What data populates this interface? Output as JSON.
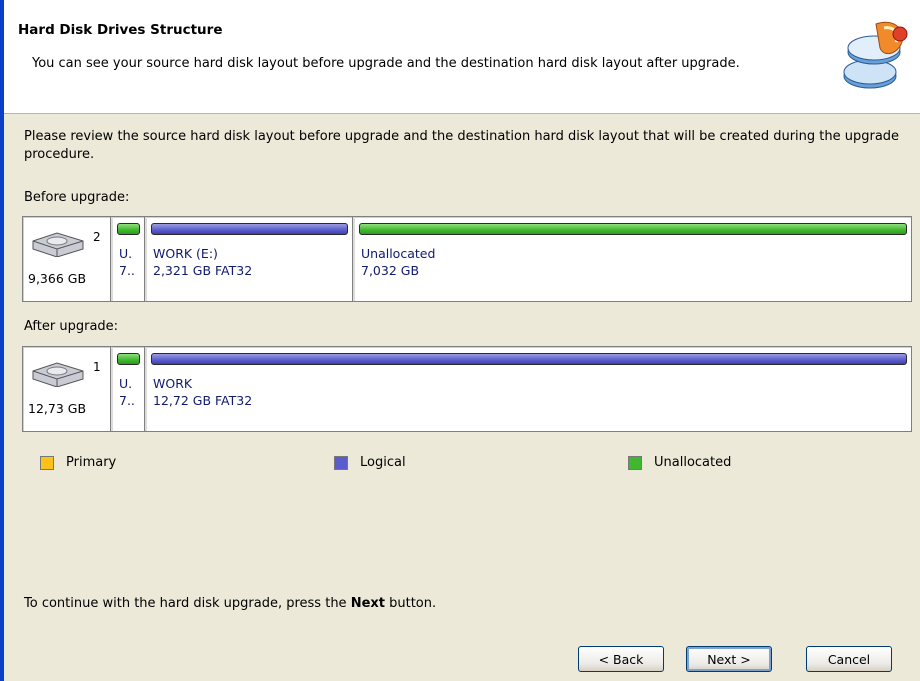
{
  "header": {
    "title": "Hard Disk Drives Structure",
    "description": "You can see your source hard disk layout before upgrade and the destination hard disk layout after upgrade.",
    "icon": "disk-wizard-icon"
  },
  "intro": "Please review the source hard disk layout before upgrade and the destination hard disk layout that will be created during the upgrade procedure.",
  "before": {
    "label": "Before upgrade:",
    "disk_number": "2",
    "disk_size": "9,366 GB",
    "partitions": [
      {
        "type": "unallocated",
        "name": "U.",
        "detail": "7.."
      },
      {
        "type": "logical",
        "name": "WORK (E:)",
        "detail": "2,321 GB  FAT32"
      },
      {
        "type": "unallocated",
        "name": "Unallocated",
        "detail": "7,032 GB"
      }
    ]
  },
  "after": {
    "label": "After upgrade:",
    "disk_number": "1",
    "disk_size": "12,73 GB",
    "partitions": [
      {
        "type": "unallocated",
        "name": "U.",
        "detail": "7.."
      },
      {
        "type": "logical",
        "name": "WORK",
        "detail": "12,72 GB  FAT32"
      }
    ]
  },
  "legend": {
    "primary": {
      "label": "Primary",
      "color": "#ffc21a"
    },
    "logical": {
      "label": "Logical",
      "color": "#5a5ccd"
    },
    "unallocated": {
      "label": "Unallocated",
      "color": "#41b62f"
    }
  },
  "footer": {
    "prefix": "To continue with the hard disk upgrade, press the ",
    "bold": "Next",
    "suffix": " button."
  },
  "buttons": {
    "back": "< Back",
    "next": "Next >",
    "cancel": "Cancel"
  }
}
